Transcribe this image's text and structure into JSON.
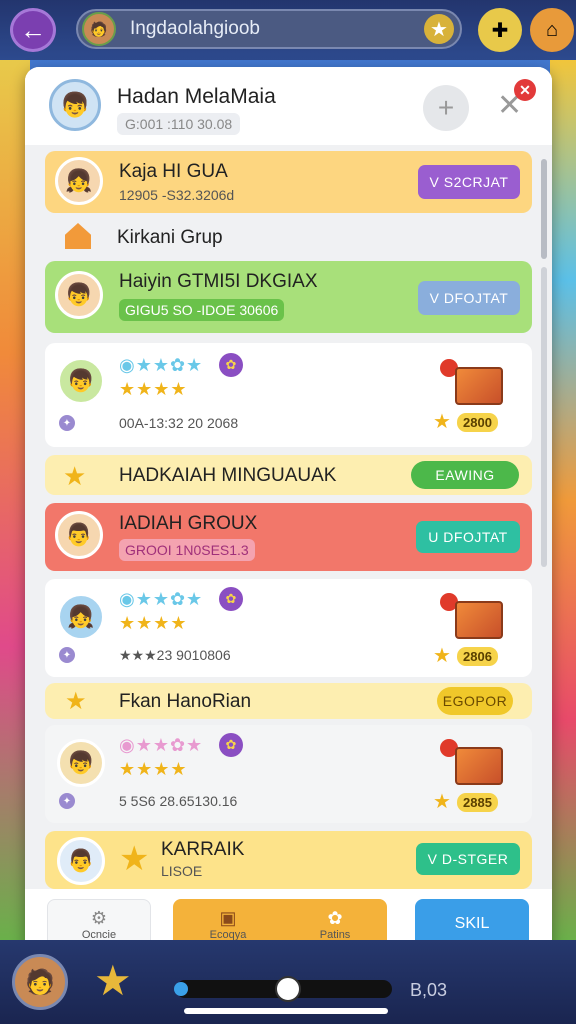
{
  "topbar": {
    "search_text": "Ingdaolahgioob"
  },
  "panel": {
    "title": "Hadan MelaMaia",
    "subtitle": "G:001 :110 30.08",
    "add_label": "+",
    "close_label": "✕",
    "close_badge": "✕"
  },
  "rows": [
    {
      "name": "Kaja HI GUA",
      "sub": "12905 -S32.3206d",
      "button": "V S2CRJAT",
      "color": "#fdd680",
      "btn_color": "#9a5ed0"
    },
    {
      "section": "Kirkani Grup"
    },
    {
      "name": "Haiyin GTMI5I DKGIAX",
      "sub": "GIGU5 SO -IDOE 30606",
      "button": "V DFOJTAT",
      "color": "#a8e07a",
      "btn_color": "#8aaedc"
    },
    {
      "stars_text": "★★★★",
      "sub": "00A-13:32 20 2068",
      "coin": "2800"
    },
    {
      "section_star": "HADKAIAH MINGUAUAK",
      "button": "EAWING",
      "btn_color": "#4cb84a"
    },
    {
      "name": "IADIAH GROUX",
      "sub": "GROOI 1N0SES1.3",
      "button": "U DFOJTAT",
      "color": "#f2776a",
      "btn_color": "#2ec0a2"
    },
    {
      "stars_text": "★★★★",
      "sub": "★★★23 9010806",
      "coin": "2806"
    },
    {
      "section_star": "Fkan HanoRian",
      "button": "EGOPOR",
      "btn_color": "#f0c82a"
    },
    {
      "stars_text": "★★★★",
      "sub": "5 5S6 28.65130.16",
      "coin": "2885"
    },
    {
      "name": "KARRAIK",
      "sub": "LISOE",
      "button": "V D-STGER",
      "color": "#fde38a",
      "btn_color": "#2ec08a"
    }
  ],
  "tabs": [
    {
      "label": "Ocncie"
    },
    {
      "label": "Ecoqya"
    },
    {
      "label": "Patins"
    },
    {
      "label": "SKIL"
    }
  ],
  "bottom": {
    "value": "B,03",
    "slider_fraction": 0.52
  },
  "icons": [
    "back-icon",
    "avatar",
    "star-icon",
    "plus-icon",
    "close-icon",
    "treasure-box-icon",
    "coin-icon",
    "gear-icon"
  ]
}
